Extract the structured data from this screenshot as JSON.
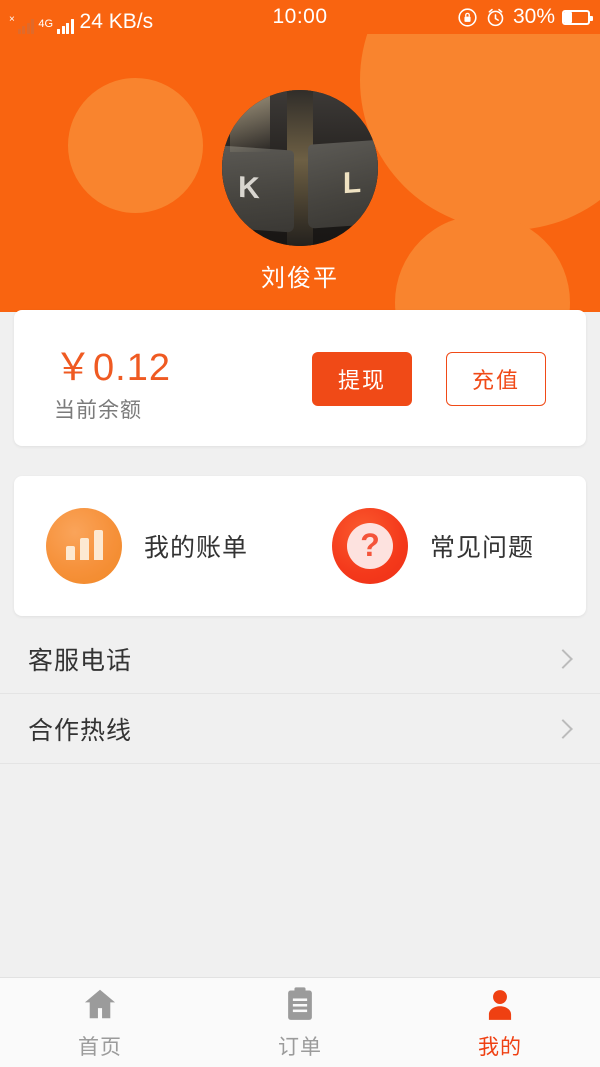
{
  "status_bar": {
    "network_speed": "24 KB/s",
    "network_type": "4G",
    "time": "10:00",
    "battery_percent": "30%",
    "icons": [
      "signal-bars-sim1-icon",
      "signal-bars-sim2-icon",
      "rotation-lock-icon",
      "alarm-clock-icon",
      "battery-icon"
    ]
  },
  "header": {
    "username": "刘俊平",
    "avatar_alt": "keyboard-keys-photo",
    "background_color": "#f96410",
    "blob_color": "#f9842e"
  },
  "balance_card": {
    "amount": "￥0.12",
    "label": "当前余额",
    "withdraw_label": "提现",
    "recharge_label": "充值",
    "accent_color": "#f04a17"
  },
  "menu_card": {
    "items": [
      {
        "label": "我的账单",
        "icon": "bar-chart-icon",
        "icon_color": "#f6913a"
      },
      {
        "label": "常见问题",
        "icon": "question-mark-icon",
        "icon_color": "#f4391b"
      }
    ]
  },
  "list_rows": [
    {
      "label": "客服电话"
    },
    {
      "label": "合作热线"
    }
  ],
  "tab_bar": {
    "tabs": [
      {
        "label": "首页",
        "icon": "home-icon",
        "active": false
      },
      {
        "label": "订单",
        "icon": "clipboard-icon",
        "active": false
      },
      {
        "label": "我的",
        "icon": "person-icon",
        "active": true
      }
    ],
    "active_color": "#ef4012",
    "inactive_color": "#9b9b9b"
  }
}
